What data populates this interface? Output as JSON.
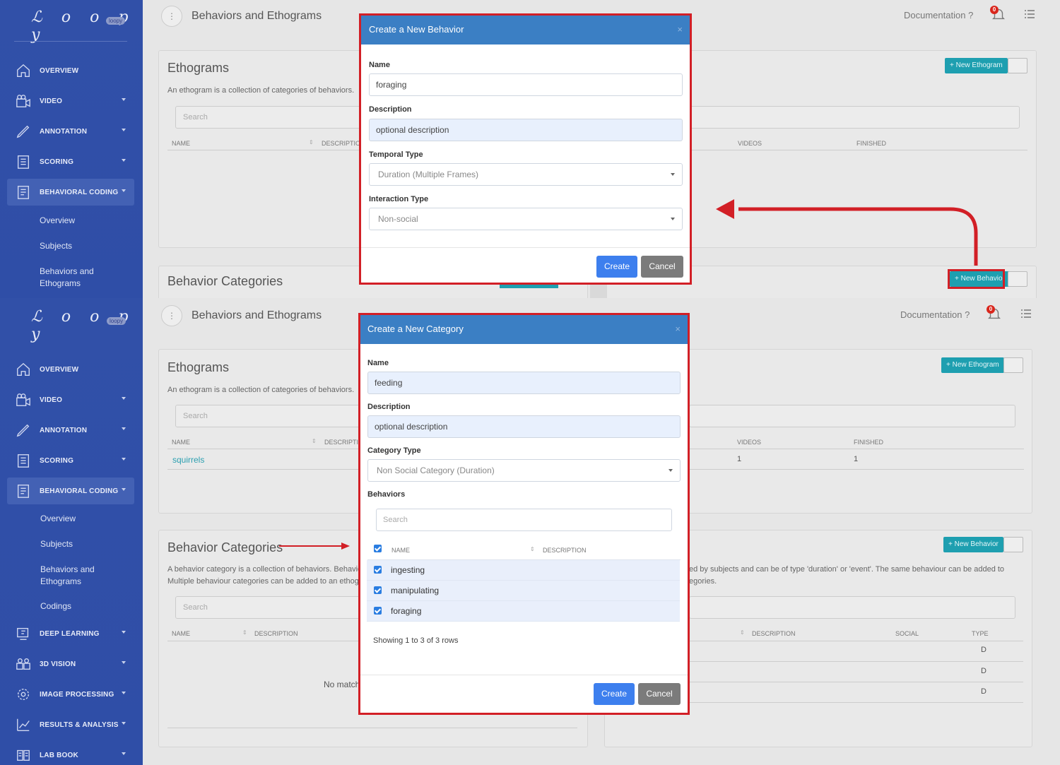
{
  "app": {
    "logo": "Loopy",
    "logo_badge": "loopy"
  },
  "sidebar": {
    "items": [
      {
        "label": "OVERVIEW",
        "icon": "home-icon"
      },
      {
        "label": "VIDEO",
        "icon": "video-camera-icon"
      },
      {
        "label": "ANNOTATION",
        "icon": "pencil-icon"
      },
      {
        "label": "SCORING",
        "icon": "clipboard-list-icon"
      },
      {
        "label": "BEHAVIORAL CODING",
        "icon": "clipboard-icon"
      },
      {
        "label": "DEEP LEARNING",
        "icon": "brain-icon"
      },
      {
        "label": "3D VISION",
        "icon": "cameras-icon"
      },
      {
        "label": "IMAGE PROCESSING",
        "icon": "gear-icon"
      },
      {
        "label": "RESULTS & ANALYSIS",
        "icon": "chart-icon"
      },
      {
        "label": "LAB BOOK",
        "icon": "book-icon"
      }
    ],
    "sub_items": [
      "Overview",
      "Subjects",
      "Behaviors and Ethograms",
      "Codings"
    ]
  },
  "header": {
    "title": "Behaviors and Ethograms",
    "documentation": "Documentation",
    "help": "?",
    "notifications": "0",
    "kebab": "⋮"
  },
  "ethograms": {
    "title": "Ethograms",
    "description": "An ethogram is a collection of categories of behaviors.",
    "search_placeholder": "Search",
    "columns": [
      "NAME",
      "DESCRIPTION",
      "VIDEOS",
      "FINISHED"
    ],
    "rows": [
      {
        "name": "squirrels",
        "videos": "1",
        "finished": "1"
      }
    ],
    "new_button": "+ New Ethogram"
  },
  "categories": {
    "title": "Behavior Categories",
    "description_line1": "A behavior category is a collection of behaviors. Behavio",
    "description_line2": "Multiple behaviour categories can be added to an ethog",
    "search_placeholder": "Search",
    "columns": [
      "NAME",
      "DESCRIPTION"
    ],
    "empty": "No match"
  },
  "behaviors": {
    "description_line1": "ed by subjects and can be of type 'duration' or 'event'. The same behaviour can be added to",
    "description_line2": "egories.",
    "columns": [
      "DESCRIPTION",
      "SOCIAL",
      "TYPE"
    ],
    "types": [
      "D",
      "D",
      "D"
    ],
    "new_button": "+ New Behavior"
  },
  "behavior_modal": {
    "title": "Create a New Behavior",
    "close": "×",
    "name_label": "Name",
    "name_value": "foraging",
    "desc_label": "Description",
    "desc_value": "optional description",
    "temporal_label": "Temporal Type",
    "temporal_value": "Duration (Multiple Frames)",
    "interaction_label": "Interaction Type",
    "interaction_value": "Non-social",
    "create": "Create",
    "cancel": "Cancel"
  },
  "category_modal": {
    "title": "Create a New Category",
    "close": "×",
    "name_label": "Name",
    "name_value": "feeding",
    "desc_label": "Description",
    "desc_value": "optional description",
    "type_label": "Category Type",
    "type_value": "Non Social Category (Duration)",
    "behaviors_label": "Behaviors",
    "search_placeholder": "Search",
    "col_name": "NAME",
    "col_desc": "DESCRIPTION",
    "rows": [
      "ingesting",
      "manipulating",
      "foraging"
    ],
    "pagination": "Showing 1 to 3 of 3 rows",
    "create": "Create",
    "cancel": "Cancel"
  },
  "colors": {
    "sidebar": "#3150a8",
    "modal_header": "#3b7fc4",
    "highlight": "#d21f26",
    "teal": "#1e9fb0",
    "primary": "#3d7fee"
  }
}
